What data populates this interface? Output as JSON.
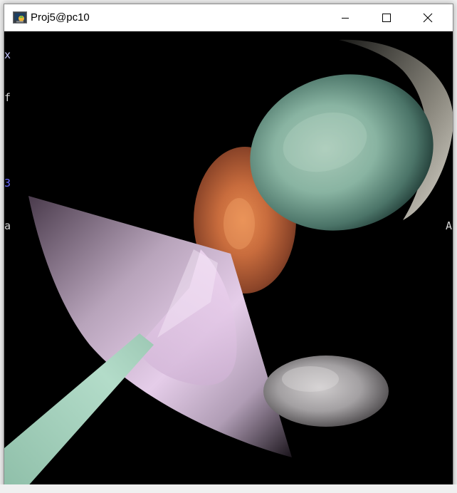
{
  "window": {
    "title": "Proj5@pc10",
    "icon": "opengl-app-icon",
    "controls": {
      "minimize": "minimize-icon",
      "maximize": "maximize-icon",
      "close": "close-icon"
    }
  },
  "render_view": {
    "background_color": "#000000",
    "edge_text": {
      "left_1": "x",
      "left_2": "f",
      "left_3": "3",
      "left_4": "a",
      "right_1": "A"
    },
    "objects": [
      {
        "name": "teal-sphere",
        "color": "#9ec4b2"
      },
      {
        "name": "orange-sphere",
        "color": "#d47a43"
      },
      {
        "name": "pink-cone",
        "color": "#e8cfee"
      },
      {
        "name": "mint-cone",
        "color": "#a9d6c2"
      },
      {
        "name": "gray-ellipsoid",
        "color": "#a9a6a8"
      },
      {
        "name": "gray-shell",
        "color": "#c9c6bd"
      }
    ]
  }
}
